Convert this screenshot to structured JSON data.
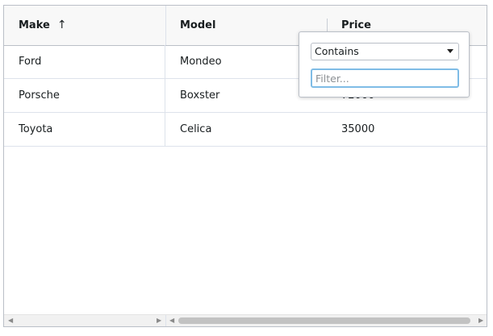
{
  "columns": [
    {
      "label": "Make",
      "sort": "ascending"
    },
    {
      "label": "Model"
    },
    {
      "label": "Price"
    }
  ],
  "rows": [
    {
      "make": "Ford",
      "model": "Mondeo",
      "price": ""
    },
    {
      "make": "Porsche",
      "model": "Boxster",
      "price": "72000"
    },
    {
      "make": "Toyota",
      "model": "Celica",
      "price": "35000"
    }
  ],
  "icons": {
    "sort": "arrow-up-icon",
    "scroll_left": "chevron-left-icon",
    "scroll_right": "chevron-right-icon",
    "dropdown": "caret-down-icon"
  },
  "filter_popup": {
    "operator": "Contains",
    "placeholder": "Filter...",
    "value": ""
  },
  "colors": {
    "border": "#babfc7",
    "header_bg": "#f8f8f8",
    "focus_border": "#7fbce6"
  }
}
